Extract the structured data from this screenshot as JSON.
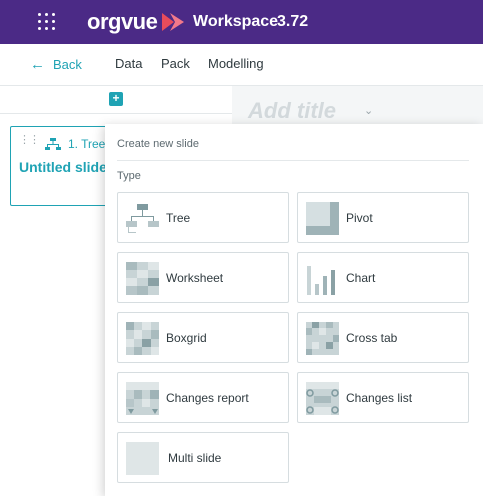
{
  "header": {
    "logo_text": "orgvue",
    "workspace_label": "Workspace",
    "version": "3.72",
    "colors": {
      "bar": "#4b2a86",
      "logo_mark": "#e84c5b"
    }
  },
  "nav": {
    "back_label": "Back",
    "items": [
      {
        "label": "Data"
      },
      {
        "label": "Pack"
      },
      {
        "label": "Modelling"
      }
    ]
  },
  "slide_panel": {
    "add_label": "+",
    "slides": [
      {
        "type_label": "1. Tree",
        "name": "Untitled slide"
      }
    ]
  },
  "canvas": {
    "title_placeholder": "Add title",
    "title_caret": "⌄"
  },
  "new_slide_menu": {
    "header": "Create new slide",
    "type_label": "Type",
    "options": [
      {
        "label": "Tree",
        "icon": "tree-icon"
      },
      {
        "label": "Pivot",
        "icon": "pivot-icon"
      },
      {
        "label": "Worksheet",
        "icon": "worksheet-icon"
      },
      {
        "label": "Chart",
        "icon": "chart-icon"
      },
      {
        "label": "Boxgrid",
        "icon": "boxgrid-icon"
      },
      {
        "label": "Cross tab",
        "icon": "cross-tab-icon"
      },
      {
        "label": "Changes report",
        "icon": "changes-report-icon"
      },
      {
        "label": "Changes list",
        "icon": "changes-list-icon"
      },
      {
        "label": "Multi slide",
        "icon": "multi-slide-icon"
      }
    ]
  },
  "accent_color": "#1fa3b4"
}
